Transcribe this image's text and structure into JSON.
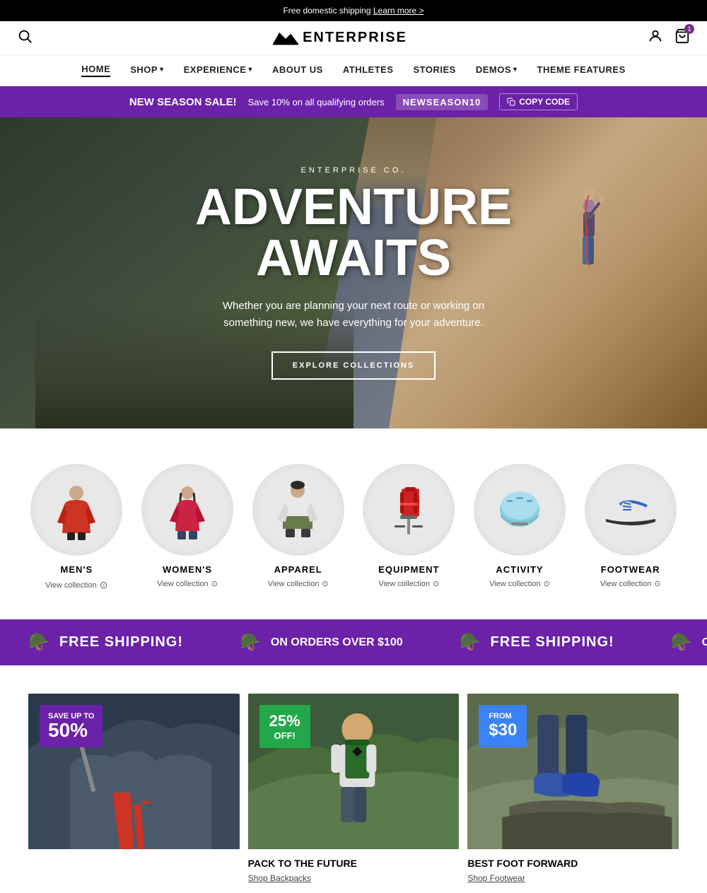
{
  "announcement": {
    "text": "Free domestic shipping",
    "link": "Learn more >"
  },
  "header": {
    "logo": "ENTERPRISE",
    "logo_icon": "mountain-icon",
    "search_label": "search",
    "account_label": "account",
    "cart_label": "cart",
    "cart_count": "1"
  },
  "nav": {
    "items": [
      {
        "label": "HOME",
        "active": true,
        "has_dropdown": false
      },
      {
        "label": "SHOP",
        "active": false,
        "has_dropdown": true
      },
      {
        "label": "EXPERIENCE",
        "active": false,
        "has_dropdown": true
      },
      {
        "label": "ABOUT US",
        "active": false,
        "has_dropdown": false
      },
      {
        "label": "ATHLETES",
        "active": false,
        "has_dropdown": false
      },
      {
        "label": "STORIES",
        "active": false,
        "has_dropdown": false
      },
      {
        "label": "DEMOS",
        "active": false,
        "has_dropdown": true
      },
      {
        "label": "THEME FEATURES",
        "active": false,
        "has_dropdown": false
      }
    ]
  },
  "sale_banner": {
    "title": "NEW SEASON SALE!",
    "description": "Save 10% on all qualifying orders",
    "code": "NEWSEASON10",
    "copy_label": "COPY CODE"
  },
  "hero": {
    "brand": "ENTERPRISE CO.",
    "title_line1": "ADVENTURE",
    "title_line2": "AWAITS",
    "subtitle": "Whether you are planning your next route or working on something new, we have everything for your adventure.",
    "cta": "EXPLORE COLLECTIONS"
  },
  "collections": {
    "items": [
      {
        "name": "MEN'S",
        "link": "View collection"
      },
      {
        "name": "WOMEN'S",
        "link": "View collection"
      },
      {
        "name": "APPAREL",
        "link": "View collection"
      },
      {
        "name": "EQUIPMENT",
        "link": "View collection"
      },
      {
        "name": "ACTIVITY",
        "link": "View collection"
      },
      {
        "name": "FOOTWEAR",
        "link": "View collection"
      }
    ]
  },
  "shipping_banner": {
    "text": "FREE SHIPPING!",
    "subtext": "ON ORDERS OVER $100"
  },
  "promos": {
    "items": [
      {
        "badge_small": "SAVE UP TO",
        "badge_large": "50%",
        "title": "",
        "link": ""
      },
      {
        "badge_percent": "25%",
        "badge_off": "OFF!",
        "title": "PACK TO THE FUTURE",
        "link": "Shop Backpacks"
      },
      {
        "badge_from": "FROM",
        "badge_price": "$30",
        "title": "BEST FOOT FORWARD",
        "link": "Shop Footwear"
      }
    ]
  }
}
